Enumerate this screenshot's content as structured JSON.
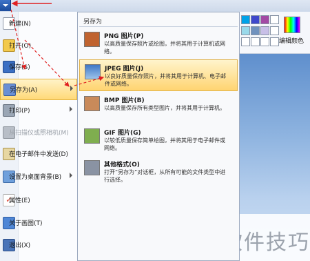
{
  "menu": {
    "items": [
      {
        "label": "新建(N)",
        "icon": "new-file-icon",
        "color": "#ffffff",
        "disabled": false,
        "submenu": false
      },
      {
        "label": "打开(O)",
        "icon": "open-folder-icon",
        "color": "#f2c94c",
        "disabled": false,
        "submenu": false
      },
      {
        "label": "保存(S)",
        "icon": "save-disk-icon",
        "color": "#3b6fc4",
        "disabled": false,
        "submenu": false
      },
      {
        "label": "另存为(A)",
        "icon": "save-as-icon",
        "color": "#6a8fd4",
        "disabled": false,
        "submenu": true
      },
      {
        "label": "打印(P)",
        "icon": "printer-icon",
        "color": "#9aa6b5",
        "disabled": false,
        "submenu": true
      },
      {
        "label": "从扫描仪或照相机(M)",
        "icon": "scanner-icon",
        "color": "#b8bec7",
        "disabled": true,
        "submenu": false
      },
      {
        "label": "在电子邮件中发送(D)",
        "icon": "email-icon",
        "color": "#e7d7a2",
        "disabled": false,
        "submenu": false
      },
      {
        "label": "设置为桌面背景(B)",
        "icon": "desktop-background-icon",
        "color": "#6fa0dc",
        "disabled": false,
        "submenu": true
      },
      {
        "label": "属性(E)",
        "icon": "properties-check-icon",
        "color": "#e04a3a",
        "disabled": false,
        "submenu": false
      },
      {
        "label": "关于画图(T)",
        "icon": "about-paint-icon",
        "color": "#4e86d6",
        "disabled": false,
        "submenu": false
      },
      {
        "label": "退出(X)",
        "icon": "exit-icon",
        "color": "#4a74b8",
        "disabled": false,
        "submenu": false
      }
    ]
  },
  "submenu": {
    "title": "另存为",
    "items": [
      {
        "title": "PNG 图片(P)",
        "desc": "以高质量保存照片或绘图，并将其用于计算机或网络。",
        "icon": "png-image-icon",
        "color": "#c0632f"
      },
      {
        "title": "JPEG 图片(J)",
        "desc": "以良好质量保存照片，并将其用于计算机、电子邮件或网络。",
        "icon": "jpeg-image-icon",
        "color": "#5b8fcf"
      },
      {
        "title": "BMP 图片(B)",
        "desc": "以高质量保存所有类型图片，并将其用于计算机。",
        "icon": "bmp-image-icon",
        "color": "#c98a5a"
      },
      {
        "title": "GIF 图片(G)",
        "desc": "以较低质量保存简单绘图，并将其用于电子邮件或网络。",
        "icon": "gif-image-icon",
        "color": "#7fae4f"
      },
      {
        "title": "其他格式(O)",
        "desc": "打开“另存为”对话框，从所有可能的文件类型中进行选择。",
        "icon": "other-formats-icon",
        "color": "#8a93a3"
      }
    ]
  },
  "ribbon": {
    "edit_colors_label": "编辑颜色",
    "swatches": [
      "#00a2e8",
      "#3f48cc",
      "#a349a4",
      "#ffffff",
      "#99d9ea",
      "#7092be",
      "#c8bfe7",
      "#ffffff"
    ]
  },
  "watermark": {
    "text": "软件技巧"
  },
  "accent": {
    "annotation_red": "#e02020",
    "highlight": "#ffd978"
  }
}
